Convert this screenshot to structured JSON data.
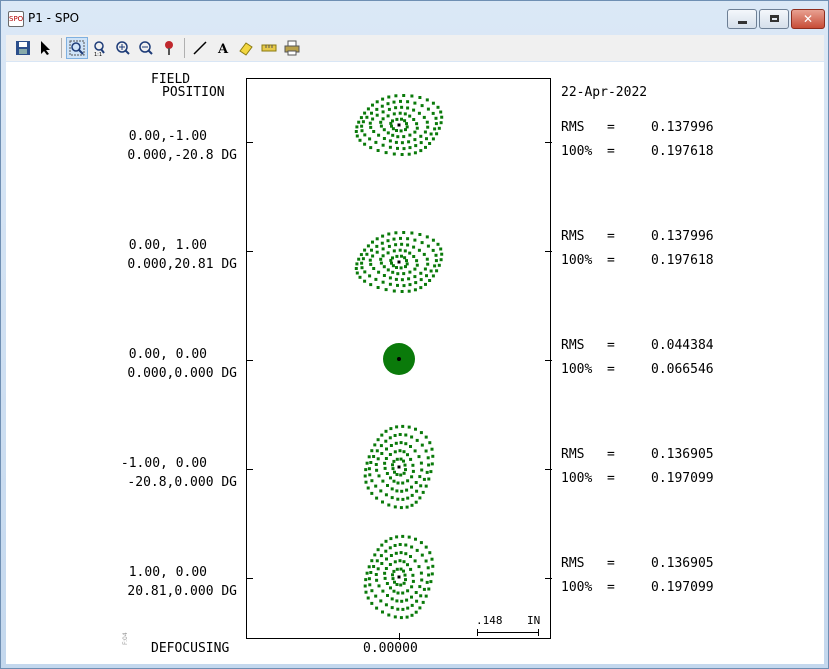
{
  "window": {
    "title": "P1 - SPO",
    "app_icon_text": "SPO",
    "buttons": {
      "minimize": "–",
      "maximize": "□",
      "close": "✕"
    }
  },
  "toolbar": {
    "icons": [
      "save-icon",
      "pointer-icon",
      "zoom-box-icon",
      "zoom-fit-icon",
      "zoom-in-icon",
      "zoom-out-icon",
      "pin-icon",
      "line-icon",
      "text-icon",
      "eraser-icon",
      "ruler-icon",
      "print-icon"
    ]
  },
  "plot": {
    "field_header_1": "FIELD",
    "field_header_2": "POSITION",
    "date": "22-Apr-2022",
    "defocusing_label": "DEFOCUSING",
    "defocusing_value": "0.00000",
    "scale_value": ".148",
    "scale_unit": "IN",
    "stamp": "F:04",
    "spot_color": "#0a7a0a",
    "fields": [
      {
        "pos": "0.00,-1.00",
        "angle": "0.000,-20.8 DG",
        "rms_label": "RMS",
        "rms_eq": "=",
        "rms": "0.137996",
        "p100_label": "100%",
        "p100_eq": "=",
        "p100": "0.197618"
      },
      {
        "pos": "0.00, 1.00",
        "angle": "0.000,20.81 DG",
        "rms_label": "RMS",
        "rms_eq": "=",
        "rms": "0.137996",
        "p100_label": "100%",
        "p100_eq": "=",
        "p100": "0.197618"
      },
      {
        "pos": "0.00, 0.00",
        "angle": "0.000,0.000 DG",
        "rms_label": "RMS",
        "rms_eq": "=",
        "rms": "0.044384",
        "p100_label": "100%",
        "p100_eq": "=",
        "p100": "0.066546"
      },
      {
        "pos": "-1.00, 0.00",
        "angle": "-20.8,0.000 DG",
        "rms_label": "RMS",
        "rms_eq": "=",
        "rms": "0.136905",
        "p100_label": "100%",
        "p100_eq": "=",
        "p100": "0.197099"
      },
      {
        "pos": "1.00, 0.00",
        "angle": "20.81,0.000 DG",
        "rms_label": "RMS",
        "rms_eq": "=",
        "rms": "0.136905",
        "p100_label": "100%",
        "p100_eq": "=",
        "p100": "0.197099"
      }
    ]
  }
}
